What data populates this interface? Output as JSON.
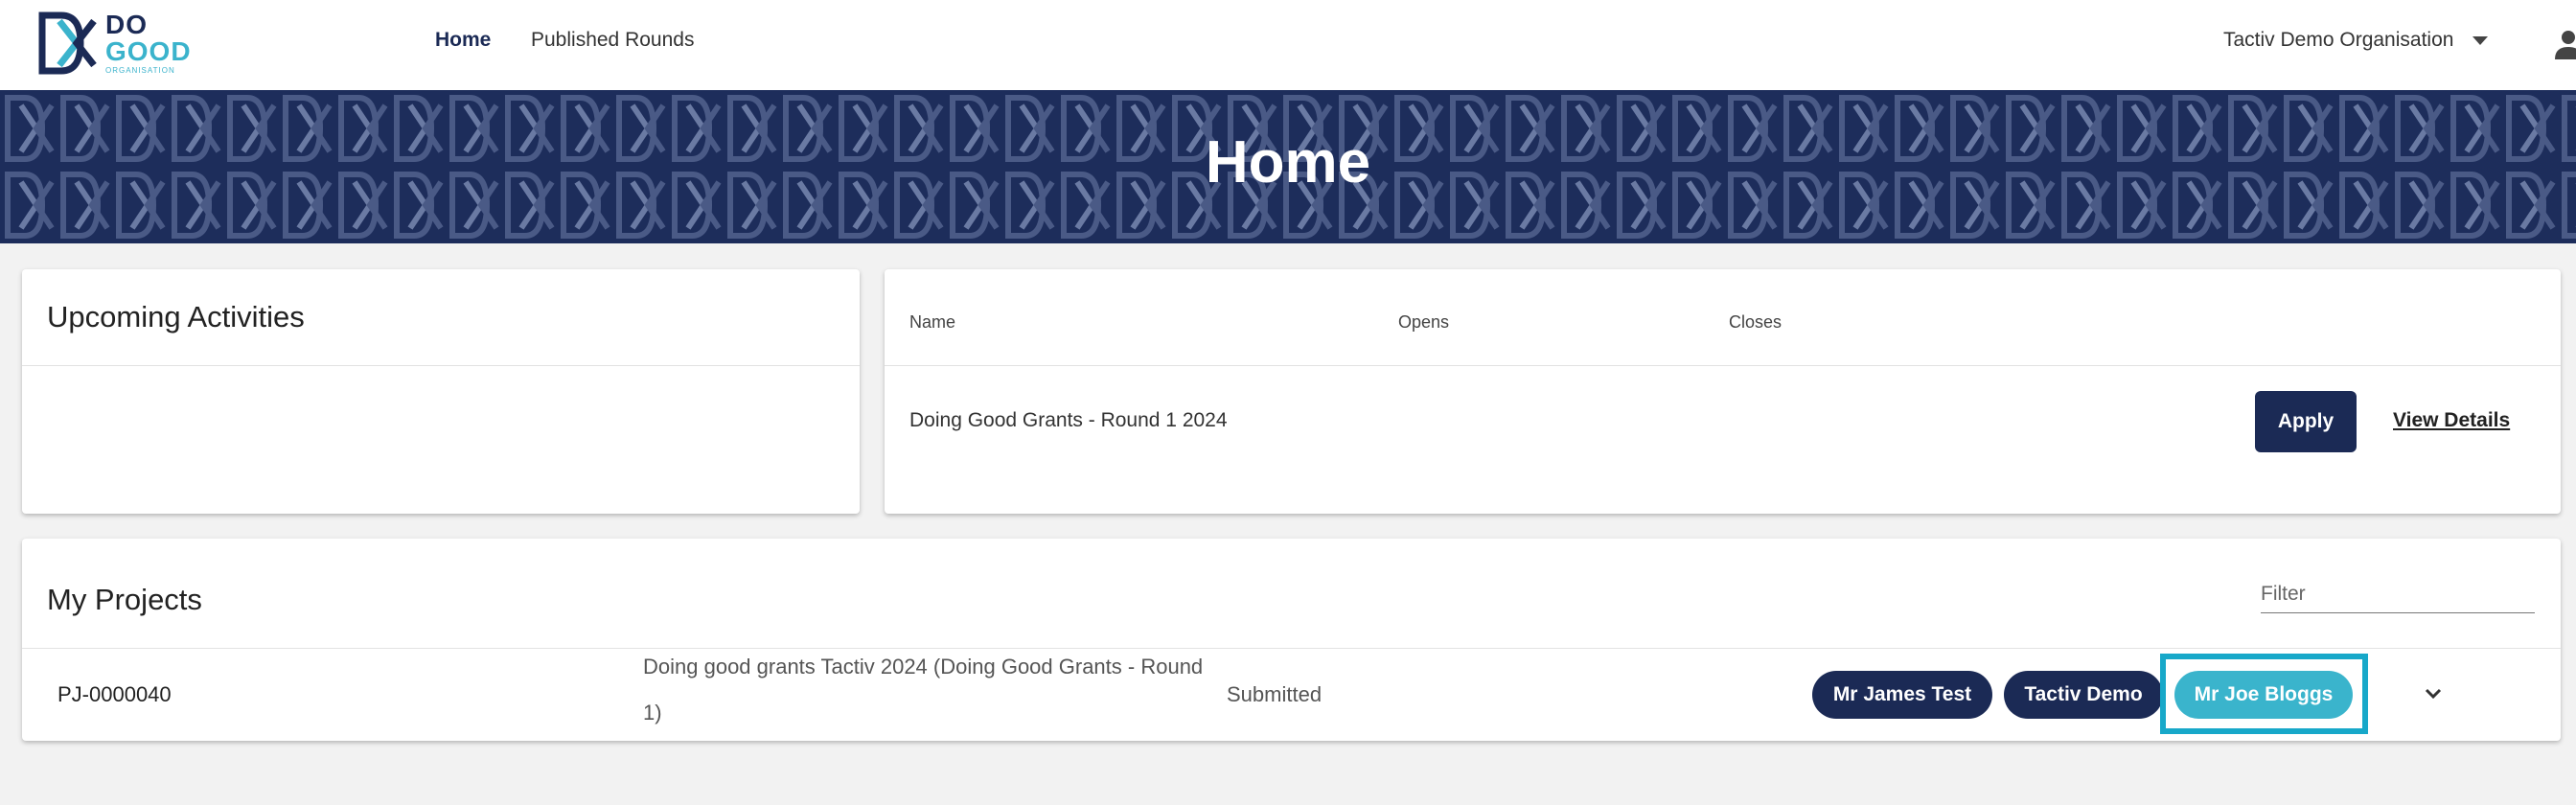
{
  "header": {
    "logo": {
      "line1": "DO",
      "line2": "GOOD",
      "line3": "ORGANISATION"
    },
    "nav": [
      {
        "label": "Home",
        "active": true
      },
      {
        "label": "Published Rounds",
        "active": false
      }
    ],
    "organisation": "Tactiv Demo Organisation"
  },
  "banner": {
    "title": "Home"
  },
  "upcoming": {
    "title": "Upcoming Activities"
  },
  "rounds": {
    "columns": [
      "Name",
      "Opens",
      "Closes"
    ],
    "rows": [
      {
        "name": "Doing Good Grants - Round 1 2024",
        "opens": "",
        "closes": "",
        "apply_label": "Apply",
        "details_label": "View Details"
      }
    ]
  },
  "projects": {
    "title": "My Projects",
    "filter_placeholder": "Filter",
    "rows": [
      {
        "id": "PJ-0000040",
        "name": "Doing good grants Tactiv 2024 (Doing Good Grants - Round 1)",
        "status": "Submitted",
        "people": [
          "Mr James Test",
          "Tactiv Demo",
          "Mr Joe Bloggs"
        ]
      }
    ]
  },
  "colors": {
    "primary": "#1b2a55",
    "accent": "#3ab4cc",
    "highlight": "#17a8c9"
  }
}
